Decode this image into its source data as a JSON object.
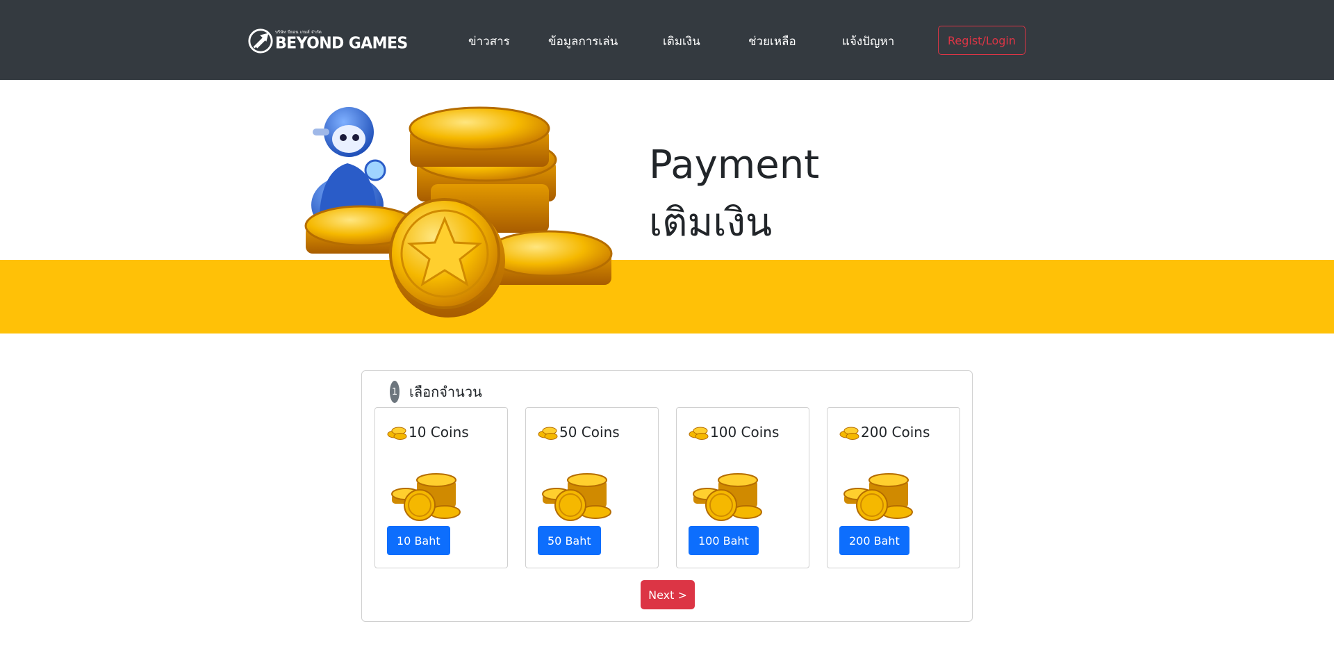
{
  "header": {
    "logo_tagline": "บริษัท บียอน เกมส์ จำกัด",
    "logo_text": "BEYOND GAMES",
    "nav": [
      {
        "label": "ข่าวสาร"
      },
      {
        "label": "ข้อมูลการเล่น"
      },
      {
        "label": "เติมเงิน"
      },
      {
        "label": "ช่วยเหลือ"
      },
      {
        "label": "แจ้งปัญหา"
      }
    ],
    "login_label": "Regist/Login"
  },
  "hero": {
    "title": "Payment",
    "subtitle": "เติมเงิน"
  },
  "payment": {
    "step_number": "1",
    "step_label": "เลือกจำนวน",
    "options": [
      {
        "coins": "10 Coins",
        "price": "10 Baht"
      },
      {
        "coins": "50 Coins",
        "price": "50 Baht"
      },
      {
        "coins": "100 Coins",
        "price": "100 Baht"
      },
      {
        "coins": "200 Coins",
        "price": "200 Baht"
      }
    ],
    "next_label": "Next >"
  },
  "colors": {
    "navbar": "#343a40",
    "accent_band": "#ffc107",
    "primary_button": "#0d6efd",
    "danger": "#dc3545"
  }
}
